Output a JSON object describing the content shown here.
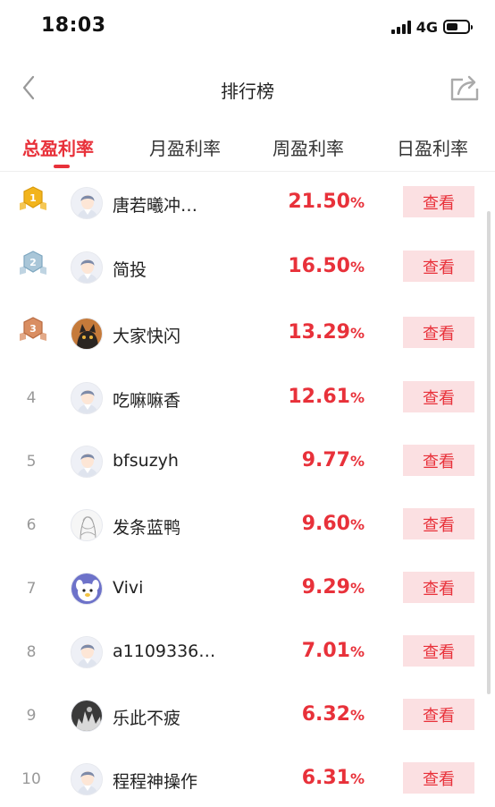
{
  "status": {
    "time": "18:03",
    "network": "4G"
  },
  "header": {
    "title": "排行榜"
  },
  "tabs": [
    {
      "label": "总盈利率",
      "active": true
    },
    {
      "label": "月盈利率",
      "active": false
    },
    {
      "label": "周盈利率",
      "active": false
    },
    {
      "label": "日盈利率",
      "active": false
    }
  ],
  "colors": {
    "accent": "#e8313a",
    "button_bg": "#fbe0e2",
    "gold": "#f2b41c",
    "silver": "#a9c6d8",
    "bronze": "#d98e62"
  },
  "view_label": "查看",
  "rows": [
    {
      "rank": "1",
      "medal": "gold",
      "avatar": "default-avatar-icon",
      "name": "唐若曦冲…",
      "rate": "21.50",
      "unit": "%"
    },
    {
      "rank": "2",
      "medal": "silver",
      "avatar": "default-avatar-icon",
      "name": "简投",
      "rate": "16.50",
      "unit": "%"
    },
    {
      "rank": "3",
      "medal": "bronze",
      "avatar": "cat-avatar-icon",
      "name": "大家快闪",
      "rate": "13.29",
      "unit": "%"
    },
    {
      "rank": "4",
      "medal": "",
      "avatar": "default-avatar-icon",
      "name": "吃嘛嘛香",
      "rate": "12.61",
      "unit": "%"
    },
    {
      "rank": "5",
      "medal": "",
      "avatar": "default-avatar-icon",
      "name": "bfsuzyh",
      "rate": "9.77",
      "unit": "%"
    },
    {
      "rank": "6",
      "medal": "",
      "avatar": "sketch-avatar-icon",
      "name": "发条蓝鸭",
      "rate": "9.60",
      "unit": "%"
    },
    {
      "rank": "7",
      "medal": "",
      "avatar": "cartoon-avatar-icon",
      "name": "Vivi",
      "rate": "9.29",
      "unit": "%"
    },
    {
      "rank": "8",
      "medal": "",
      "avatar": "default-avatar-icon",
      "name": "a1109336…",
      "rate": "7.01",
      "unit": "%"
    },
    {
      "rank": "9",
      "medal": "",
      "avatar": "photo-avatar-icon",
      "name": "乐此不疲",
      "rate": "6.32",
      "unit": "%"
    },
    {
      "rank": "10",
      "medal": "",
      "avatar": "default-avatar-icon",
      "name": "程程神操作",
      "rate": "6.31",
      "unit": "%"
    }
  ]
}
